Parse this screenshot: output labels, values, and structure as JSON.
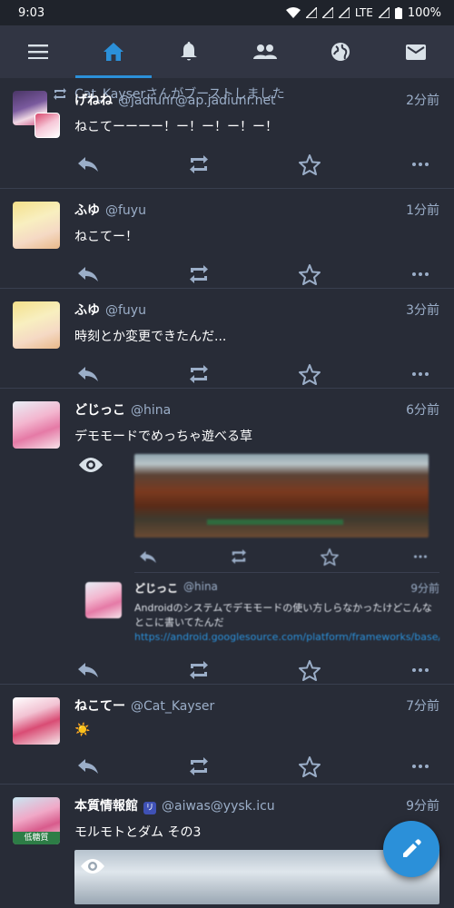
{
  "status_bar": {
    "time": "9:03",
    "network": "LTE",
    "battery": "100%"
  },
  "tabs": [
    {
      "id": "menu",
      "icon": "menu-icon"
    },
    {
      "id": "home",
      "icon": "home-icon",
      "active": true
    },
    {
      "id": "notifications",
      "icon": "bell-icon"
    },
    {
      "id": "local",
      "icon": "people-icon"
    },
    {
      "id": "federated",
      "icon": "globe-icon"
    },
    {
      "id": "direct",
      "icon": "mail-icon"
    }
  ],
  "boost_text": "Cat_Kayserさんがブーストしました",
  "posts": [
    {
      "display_name": "げねね",
      "acct": "@jadiunr@ap.jadiunr.net",
      "time": "2分前",
      "content": "ねこてーーーー！ー！ー！ー！ー！"
    },
    {
      "display_name": "ふゆ",
      "acct": "@fuyu",
      "time": "1分前",
      "content": "ねこてー！"
    },
    {
      "display_name": "ふゆ",
      "acct": "@fuyu",
      "time": "3分前",
      "content": "時刻とか変更できたんだ..."
    },
    {
      "display_name": "どじっこ",
      "acct": "@hina",
      "time": "6分前",
      "content": "デモモードでめっちゃ遊べる草",
      "quote": {
        "display_name": "どじっこ",
        "acct": "@hina",
        "time": "9分前",
        "text": "Androidのシステムでデモモードの使い方しらなかったけどこんなとこに書いてたんだ ",
        "link": "https://android.googlesource.com/platform/frameworks/base/+/master/packages/SystemUI/docs/demo_mode.md"
      }
    },
    {
      "display_name": "ねこてー",
      "acct": "@Cat_Kayser",
      "time": "7分前",
      "content": "☀️"
    },
    {
      "display_name": "本質情報館",
      "acct": "@aiwas@yysk.icu",
      "time": "9分前",
      "content": "モルモトとダム その3",
      "badge": "低糖質",
      "verified": "リ"
    }
  ],
  "colors": {
    "background": "#282c37",
    "tabbar": "#313543",
    "accent": "#2b90d9",
    "secondary_text": "#9baec8"
  }
}
